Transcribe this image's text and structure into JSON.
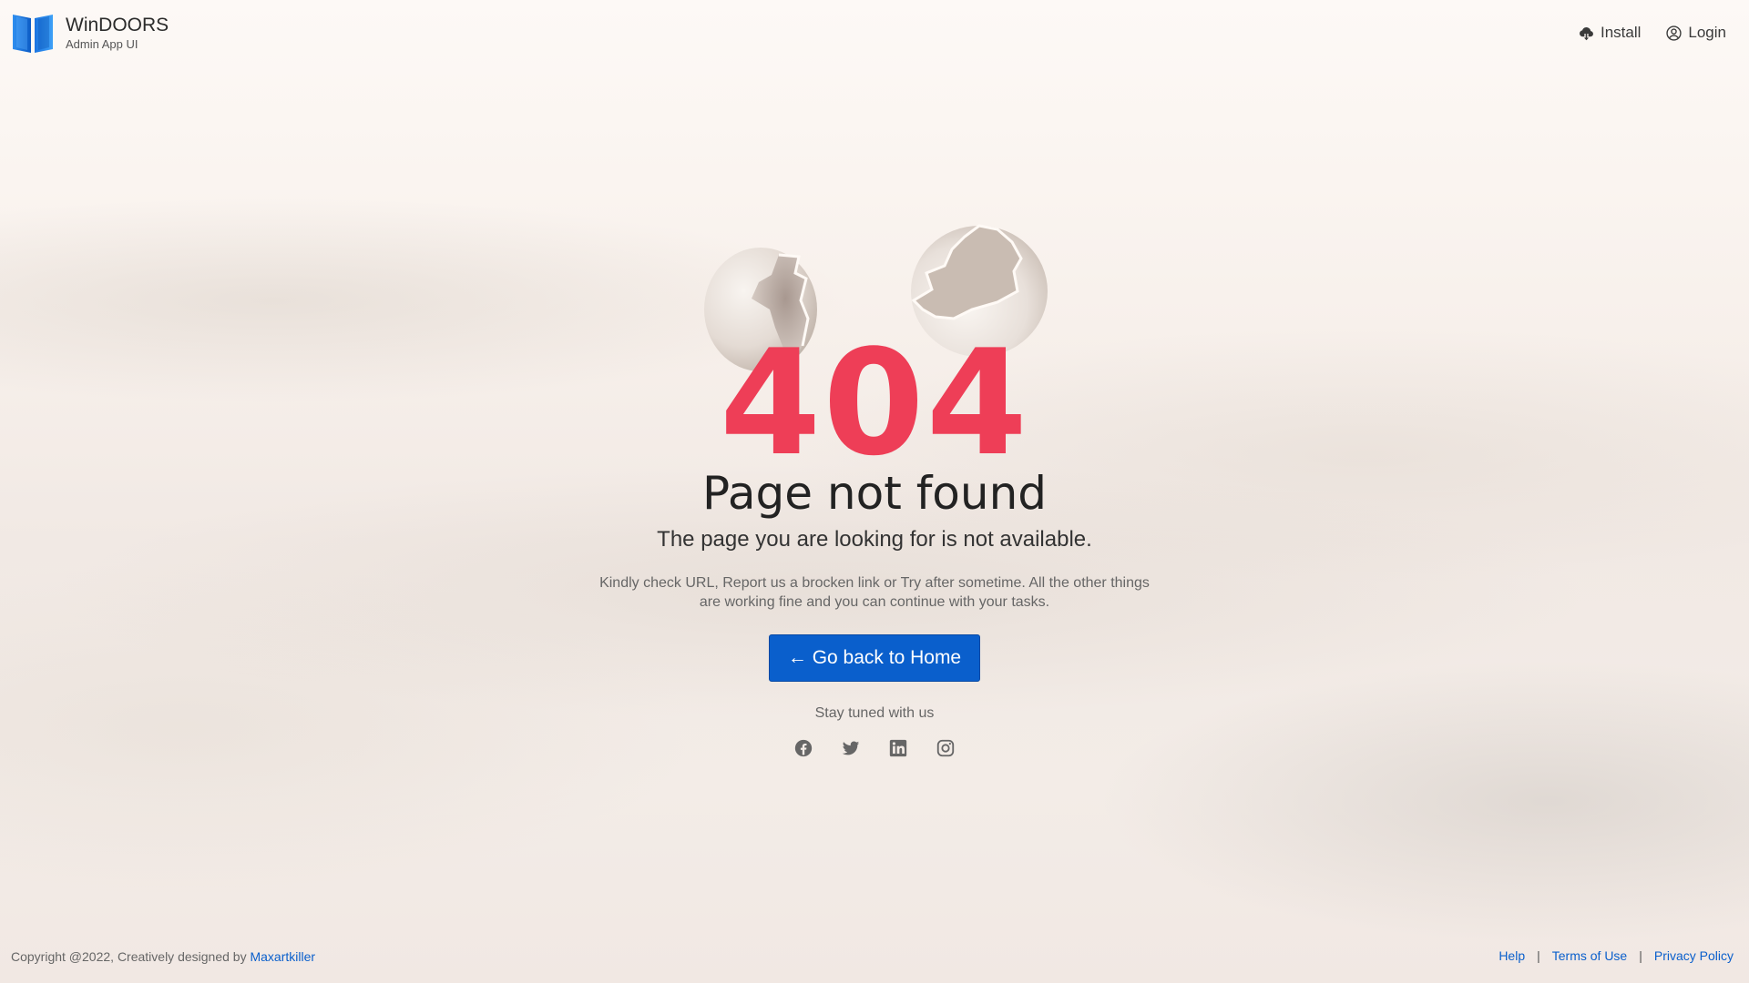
{
  "brand": {
    "title": "WinDOORS",
    "subtitle": "Admin App UI",
    "logo_icon": "windoors-logo-icon"
  },
  "header": {
    "install_label": "Install",
    "install_icon": "cloud-download-icon",
    "login_label": "Login",
    "login_icon": "user-circle-icon"
  },
  "error": {
    "code": "404",
    "title": "Page not found",
    "subtitle": "The page you are looking for is not available.",
    "description_line1": "Kindly check URL, Report us a brocken link or Try after sometime. All the other things",
    "description_line2": "are working fine and you can continue with your tasks.",
    "illustration": "cracked-egg-shells"
  },
  "actions": {
    "home_button_label": "← Go back to Home"
  },
  "social": {
    "heading": "Stay tuned with us",
    "icons": [
      "facebook-icon",
      "twitter-icon",
      "linkedin-icon",
      "instagram-icon"
    ]
  },
  "footer": {
    "copyright": "Copyright @2022, Creatively designed by ",
    "designer_link": "Maxartkiller",
    "links": [
      "Help",
      "Terms of Use",
      "Privacy Policy"
    ]
  },
  "colors": {
    "accent": "#0a5fcc",
    "error_code": "#ee3e57",
    "background": "#f6efea"
  }
}
